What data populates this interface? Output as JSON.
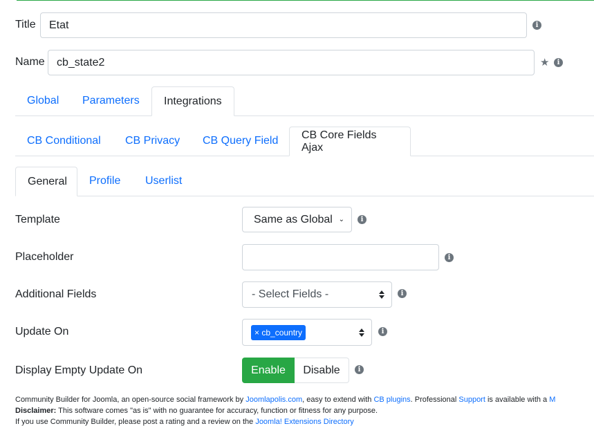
{
  "header": {
    "title_label": "Title",
    "title_value": "Etat",
    "name_label": "Name",
    "name_value": "cb_state2"
  },
  "tabs_main": [
    {
      "label": "Global",
      "active": false
    },
    {
      "label": "Parameters",
      "active": false
    },
    {
      "label": "Integrations",
      "active": true
    }
  ],
  "tabs_integrations": [
    {
      "label": "CB Conditional",
      "active": false
    },
    {
      "label": "CB Privacy",
      "active": false
    },
    {
      "label": "CB Query Field",
      "active": false
    },
    {
      "label": "CB Core Fields Ajax",
      "active": true
    }
  ],
  "tabs_sub": [
    {
      "label": "General",
      "active": true
    },
    {
      "label": "Profile",
      "active": false
    },
    {
      "label": "Userlist",
      "active": false
    }
  ],
  "form": {
    "template_label": "Template",
    "template_value": "Same as Global",
    "placeholder_label": "Placeholder",
    "placeholder_value": "",
    "additional_label": "Additional Fields",
    "additional_value": "- Select Fields -",
    "update_label": "Update On",
    "update_chip": "× cb_country",
    "display_label": "Display Empty Update On",
    "enable_label": "Enable",
    "disable_label": "Disable"
  },
  "footer": {
    "line1_a": "Community Builder for Joomla, an open-source social framework by ",
    "line1_link1": "Joomlapolis.com",
    "line1_b": ", easy to extend with ",
    "line1_link2": "CB plugins",
    "line1_c": ". Professional ",
    "line1_link3": "Support",
    "line1_d": " is available with a ",
    "line1_link4": "M",
    "line2_bold": "Disclaimer:",
    "line2_text": " This software comes \"as is\" with no guarantee for accuracy, function or fitness for any purpose.",
    "line3_a": "If you use Community Builder, please post a rating and a review on the ",
    "line3_link": "Joomla! Extensions Directory"
  },
  "colors": {
    "link": "#0d6efd",
    "success": "#28a745",
    "info_icon": "#6c757d"
  }
}
